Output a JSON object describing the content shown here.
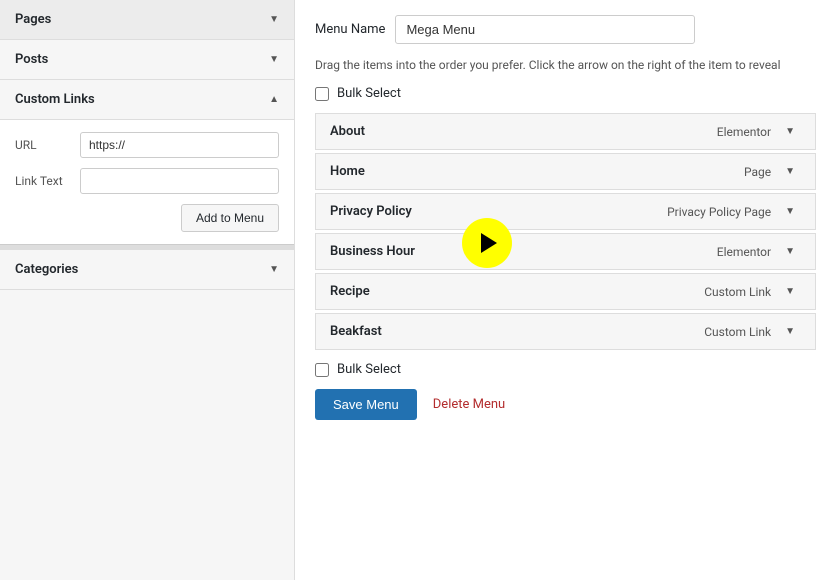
{
  "left_panel": {
    "sections": [
      {
        "id": "pages",
        "label": "Pages",
        "expanded": false
      },
      {
        "id": "posts",
        "label": "Posts",
        "expanded": false
      },
      {
        "id": "custom_links",
        "label": "Custom Links",
        "expanded": true,
        "fields": {
          "url_label": "URL",
          "url_placeholder": "https://",
          "url_value": "https://",
          "link_text_label": "Link Text",
          "link_text_placeholder": "",
          "add_btn_label": "Add to Menu"
        }
      },
      {
        "id": "categories",
        "label": "Categories",
        "expanded": false
      }
    ]
  },
  "right_panel": {
    "menu_name_label": "Menu Name",
    "menu_name_value": "Mega Menu",
    "drag_instruction": "Drag the items into the order you prefer. Click the arrow on the right of the item to reveal",
    "bulk_select_label": "Bulk Select",
    "menu_items": [
      {
        "id": "about",
        "name": "About",
        "type": "Elementor"
      },
      {
        "id": "home",
        "name": "Home",
        "type": "Page"
      },
      {
        "id": "privacy-policy",
        "name": "Privacy Policy",
        "type": "Privacy Policy Page"
      },
      {
        "id": "business-hour",
        "name": "Business Hour",
        "type": "Elementor"
      },
      {
        "id": "recipe",
        "name": "Recipe",
        "type": "Custom Link"
      },
      {
        "id": "beakfast",
        "name": "Beakfast",
        "type": "Custom Link"
      }
    ],
    "save_btn_label": "Save Menu",
    "delete_link_label": "Delete Menu"
  }
}
